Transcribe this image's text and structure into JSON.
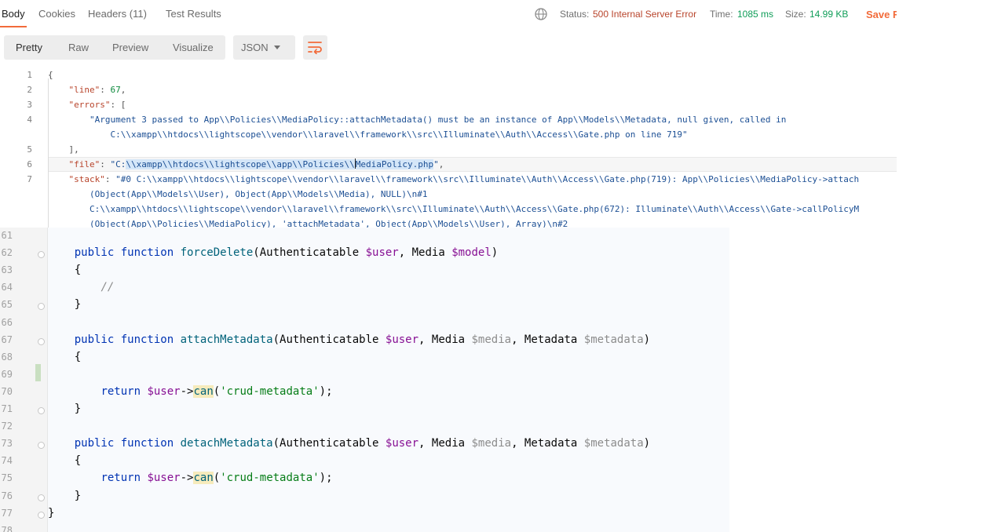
{
  "response": {
    "tabs": [
      {
        "label": "Body",
        "active": true
      },
      {
        "label": "Cookies",
        "active": false
      },
      {
        "label": "Headers (11)",
        "active": false
      },
      {
        "label": "Test Results",
        "active": false
      }
    ],
    "status": {
      "status_label": "Status:",
      "status_value": "500 Internal Server Error",
      "time_label": "Time:",
      "time_value": "1085 ms",
      "size_label": "Size:",
      "size_value": "14.99 KB",
      "save_label": "Save R"
    },
    "view_tabs": [
      {
        "label": "Pretty",
        "active": true
      },
      {
        "label": "Raw",
        "active": false
      },
      {
        "label": "Preview",
        "active": false
      },
      {
        "label": "Visualize",
        "active": false
      }
    ],
    "format": "JSON",
    "json_lines": [
      {
        "num": "1",
        "tokens": [
          {
            "t": "p",
            "v": "{"
          }
        ]
      },
      {
        "num": "2",
        "tokens": [
          {
            "t": "p",
            "v": "    "
          },
          {
            "t": "k",
            "v": "\"line\""
          },
          {
            "t": "p",
            "v": ": "
          },
          {
            "t": "n",
            "v": "67"
          },
          {
            "t": "p",
            "v": ","
          }
        ]
      },
      {
        "num": "3",
        "tokens": [
          {
            "t": "p",
            "v": "    "
          },
          {
            "t": "k",
            "v": "\"errors\""
          },
          {
            "t": "p",
            "v": ": ["
          }
        ]
      },
      {
        "num": "4",
        "tokens": [
          {
            "t": "p",
            "v": "        "
          },
          {
            "t": "s",
            "v": "\"Argument 3 passed to App\\\\Policies\\\\MediaPolicy::attachMetadata() must be an instance of App\\\\Models\\\\Metadata, null given, called in"
          }
        ]
      },
      {
        "num": "",
        "tokens": [
          {
            "t": "p",
            "v": "            "
          },
          {
            "t": "s",
            "v": "C:\\\\xampp\\\\htdocs\\\\lightscope\\\\vendor\\\\laravel\\\\framework\\\\src\\\\Illuminate\\\\Auth\\\\Access\\\\Gate.php on line 719\""
          }
        ]
      },
      {
        "num": "5",
        "tokens": [
          {
            "t": "p",
            "v": "    ],"
          }
        ]
      },
      {
        "num": "6",
        "tokens": [
          {
            "t": "p",
            "v": "    "
          },
          {
            "t": "k",
            "v": "\"file\""
          },
          {
            "t": "p",
            "v": ": "
          },
          {
            "t": "s",
            "v": "\"C:"
          },
          {
            "t": "sel",
            "v": "\\\\xampp\\\\htdocs\\\\lightscope\\\\app\\\\Policies\\\\"
          },
          {
            "t": "caret",
            "v": ""
          },
          {
            "t": "sel",
            "v": "MediaPolicy.php"
          },
          {
            "t": "s",
            "v": "\""
          },
          {
            "t": "p",
            "v": ","
          }
        ]
      },
      {
        "num": "7",
        "tokens": [
          {
            "t": "p",
            "v": "    "
          },
          {
            "t": "k",
            "v": "\"stack\""
          },
          {
            "t": "p",
            "v": ": "
          },
          {
            "t": "s",
            "v": "\"#0 C:\\\\xampp\\\\htdocs\\\\lightscope\\\\vendor\\\\laravel\\\\framework\\\\src\\\\Illuminate\\\\Auth\\\\Access\\\\Gate.php(719): App\\\\Policies\\\\MediaPolicy->attach"
          }
        ]
      },
      {
        "num": "",
        "tokens": [
          {
            "t": "p",
            "v": "        "
          },
          {
            "t": "s",
            "v": "(Object(App\\\\Models\\\\User), Object(App\\\\Models\\\\Media), NULL)\\n#1"
          }
        ]
      },
      {
        "num": "",
        "tokens": [
          {
            "t": "p",
            "v": "        "
          },
          {
            "t": "s",
            "v": "C:\\\\xampp\\\\htdocs\\\\lightscope\\\\vendor\\\\laravel\\\\framework\\\\src\\\\Illuminate\\\\Auth\\\\Access\\\\Gate.php(672): Illuminate\\\\Auth\\\\Access\\\\Gate->callPolicyM"
          }
        ]
      },
      {
        "num": "",
        "tokens": [
          {
            "t": "p",
            "v": "        "
          },
          {
            "t": "s",
            "v": "(Object(App\\\\Policies\\\\MediaPolicy), 'attachMetadata', Object(App\\\\Models\\\\User), Array)\\n#2"
          }
        ]
      }
    ]
  },
  "editor": {
    "lines": [
      {
        "num": "61",
        "fold": false,
        "tokens": []
      },
      {
        "num": "62",
        "fold": true,
        "tokens": [
          {
            "t": "p",
            "v": "    "
          },
          {
            "t": "kw",
            "v": "public function "
          },
          {
            "t": "fn",
            "v": "forceDelete"
          },
          {
            "t": "p",
            "v": "(Authenticatable "
          },
          {
            "t": "var",
            "v": "$user"
          },
          {
            "t": "p",
            "v": ", Media "
          },
          {
            "t": "var",
            "v": "$model"
          },
          {
            "t": "p",
            "v": ")"
          }
        ]
      },
      {
        "num": "63",
        "fold": false,
        "tokens": [
          {
            "t": "p",
            "v": "    {"
          }
        ]
      },
      {
        "num": "64",
        "fold": false,
        "tokens": [
          {
            "t": "p",
            "v": "        "
          },
          {
            "t": "cm",
            "v": "//"
          }
        ]
      },
      {
        "num": "65",
        "fold": true,
        "tokens": [
          {
            "t": "p",
            "v": "    }"
          }
        ]
      },
      {
        "num": "66",
        "fold": false,
        "tokens": []
      },
      {
        "num": "67",
        "fold": true,
        "tokens": [
          {
            "t": "p",
            "v": "    "
          },
          {
            "t": "kw",
            "v": "public function "
          },
          {
            "t": "fn",
            "v": "attachMetadata"
          },
          {
            "t": "p",
            "v": "(Authenticatable "
          },
          {
            "t": "var",
            "v": "$user"
          },
          {
            "t": "p",
            "v": ", Media "
          },
          {
            "t": "unused",
            "v": "$media"
          },
          {
            "t": "p",
            "v": ", Metadata "
          },
          {
            "t": "unused",
            "v": "$metadata"
          },
          {
            "t": "p",
            "v": ")"
          }
        ]
      },
      {
        "num": "68",
        "fold": false,
        "tokens": [
          {
            "t": "p",
            "v": "    {"
          }
        ]
      },
      {
        "num": "69",
        "fold": false,
        "tokens": []
      },
      {
        "num": "70",
        "fold": false,
        "tokens": [
          {
            "t": "p",
            "v": "        "
          },
          {
            "t": "kw",
            "v": "return "
          },
          {
            "t": "var",
            "v": "$user"
          },
          {
            "t": "p",
            "v": "->"
          },
          {
            "t": "meth",
            "v": "can"
          },
          {
            "t": "p",
            "v": "("
          },
          {
            "t": "str",
            "v": "'crud-metadata'"
          },
          {
            "t": "p",
            "v": ");"
          }
        ]
      },
      {
        "num": "71",
        "fold": true,
        "tokens": [
          {
            "t": "p",
            "v": "    }"
          }
        ]
      },
      {
        "num": "72",
        "fold": false,
        "tokens": []
      },
      {
        "num": "73",
        "fold": true,
        "tokens": [
          {
            "t": "p",
            "v": "    "
          },
          {
            "t": "kw",
            "v": "public function "
          },
          {
            "t": "fn",
            "v": "detachMetadata"
          },
          {
            "t": "p",
            "v": "(Authenticatable "
          },
          {
            "t": "var",
            "v": "$user"
          },
          {
            "t": "p",
            "v": ", Media "
          },
          {
            "t": "unused",
            "v": "$media"
          },
          {
            "t": "p",
            "v": ", Metadata "
          },
          {
            "t": "unused",
            "v": "$metadata"
          },
          {
            "t": "p",
            "v": ")"
          }
        ]
      },
      {
        "num": "74",
        "fold": false,
        "tokens": [
          {
            "t": "p",
            "v": "    {"
          }
        ]
      },
      {
        "num": "75",
        "fold": false,
        "tokens": [
          {
            "t": "p",
            "v": "        "
          },
          {
            "t": "kw",
            "v": "return "
          },
          {
            "t": "var",
            "v": "$user"
          },
          {
            "t": "p",
            "v": "->"
          },
          {
            "t": "meth",
            "v": "can"
          },
          {
            "t": "p",
            "v": "("
          },
          {
            "t": "str",
            "v": "'crud-metadata'"
          },
          {
            "t": "p",
            "v": ");"
          }
        ]
      },
      {
        "num": "76",
        "fold": true,
        "tokens": [
          {
            "t": "p",
            "v": "    }"
          }
        ]
      },
      {
        "num": "77",
        "fold": true,
        "tokens": [
          {
            "t": "p",
            "v": "}"
          }
        ]
      },
      {
        "num": "78",
        "fold": false,
        "tokens": []
      }
    ]
  },
  "icons": {
    "globe": "globe-icon",
    "dropdown": "chevron-down-icon",
    "wrap": "wrap-lines-icon"
  },
  "colors": {
    "accent": "#f26b3a",
    "status_error": "#b8442b",
    "status_ok": "#0f9d58"
  }
}
